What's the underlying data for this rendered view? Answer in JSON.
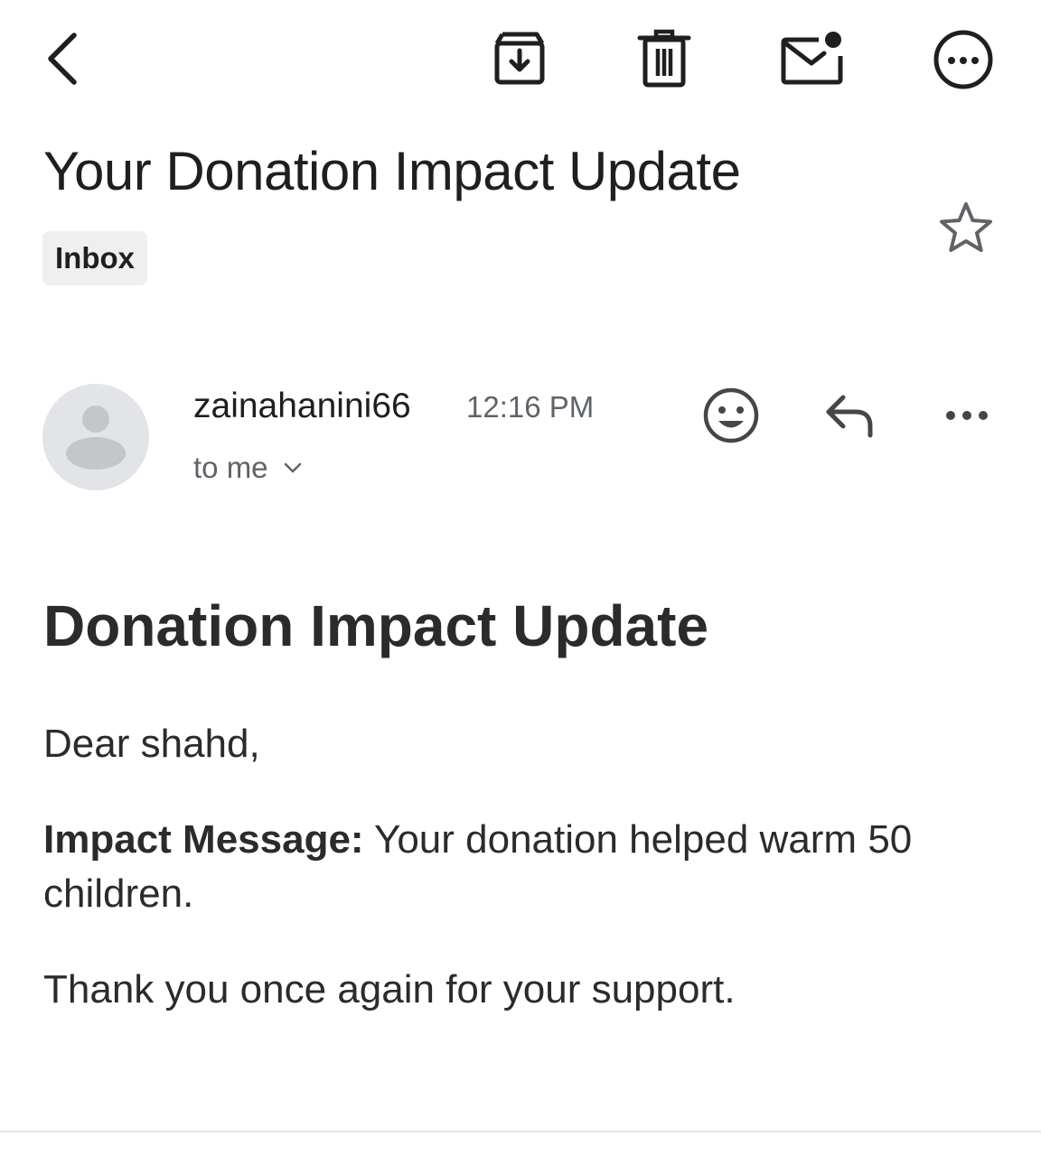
{
  "toolbar": {
    "back_icon": "chevron-left-icon",
    "archive_icon": "archive-icon",
    "delete_icon": "trash-icon",
    "mark_unread_icon": "mail-unread-icon",
    "more_icon": "more-circle-icon"
  },
  "email": {
    "subject": "Your Donation Impact Update",
    "label": "Inbox",
    "starred": false,
    "sender": "zainahanini66",
    "time": "12:16 PM",
    "recipient": "to me"
  },
  "body": {
    "heading": "Donation Impact Update",
    "greeting": "Dear shahd,",
    "impact_label": "Impact Message:",
    "impact_text": " Your donation helped warm 50 children.",
    "closing": "Thank you once again for your support."
  },
  "colors": {
    "text": "#1f1f1f",
    "secondary_text": "#5f6368",
    "chip_background": "#efefef",
    "avatar_background": "#e3e4e8",
    "avatar_figure": "#c4c6ca"
  }
}
